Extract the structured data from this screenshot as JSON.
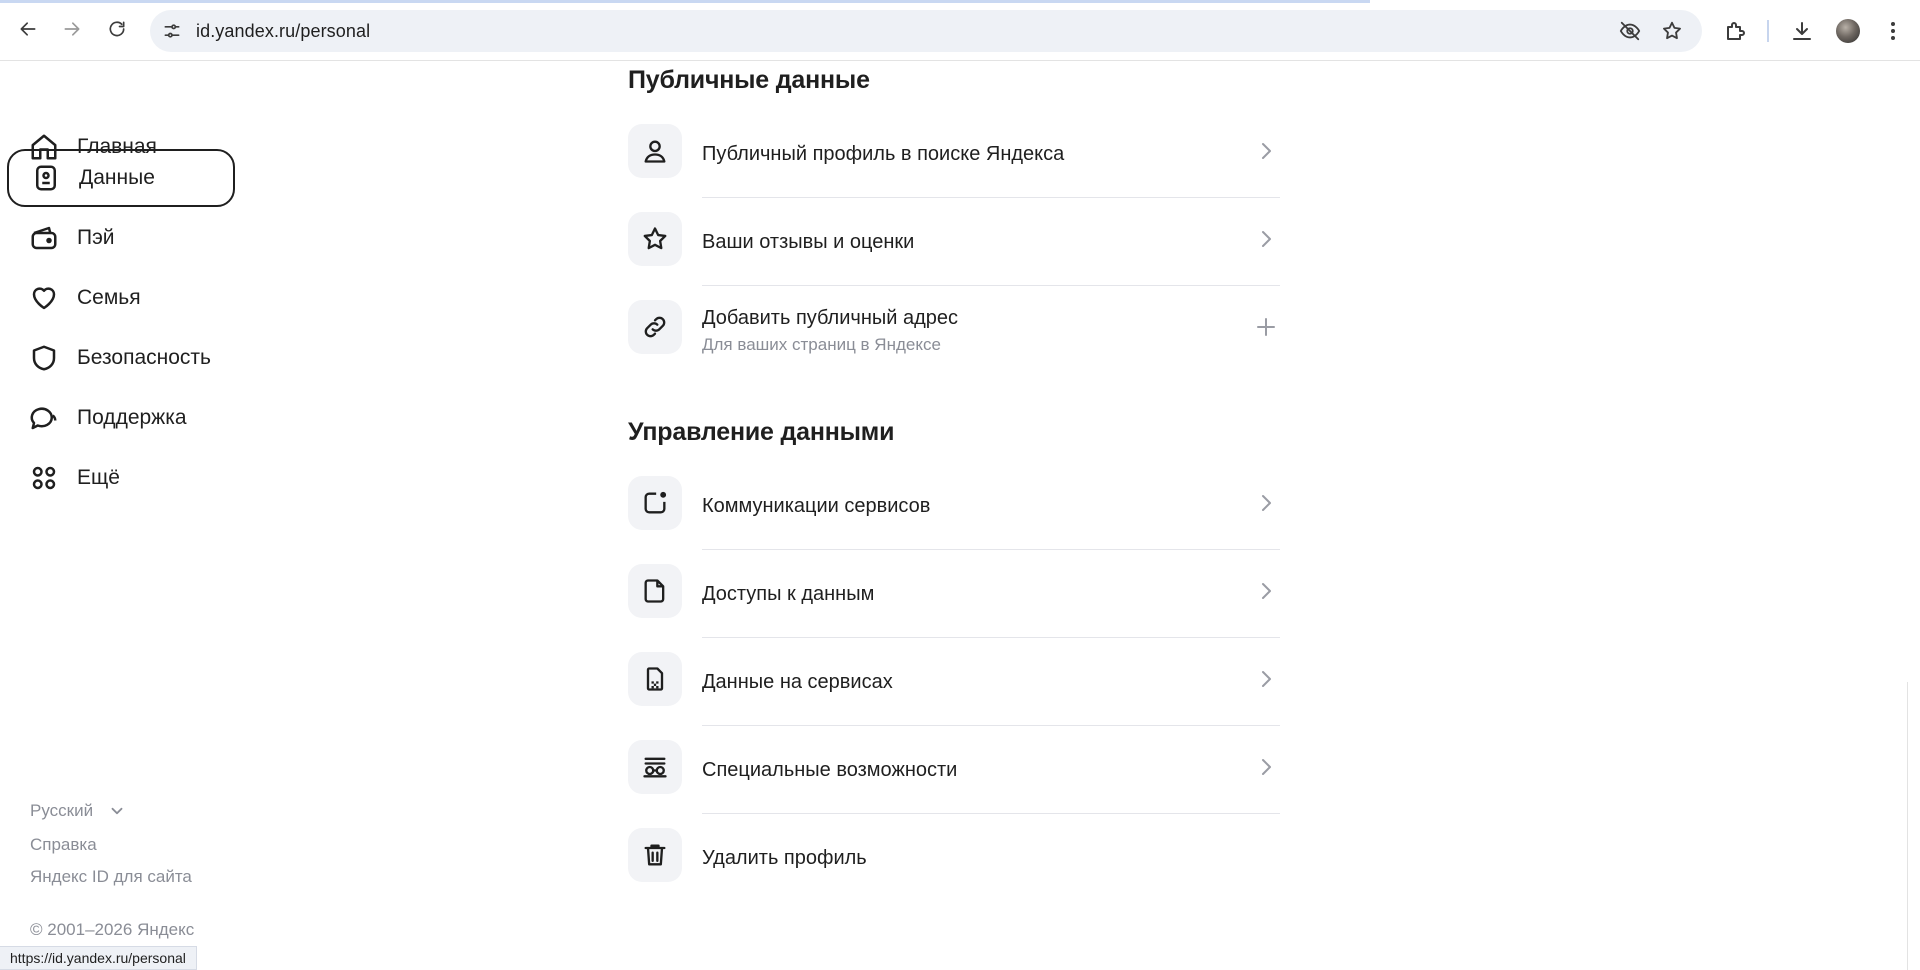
{
  "browser": {
    "url": "id.yandex.ru/personal",
    "status_url": "https://id.yandex.ru/personal"
  },
  "sidebar": {
    "items": [
      {
        "label": "Главная"
      },
      {
        "label": "Данные"
      },
      {
        "label": "Пэй"
      },
      {
        "label": "Семья"
      },
      {
        "label": "Безопасность"
      },
      {
        "label": "Поддержка"
      },
      {
        "label": "Ещё"
      }
    ],
    "active": "Данные",
    "footer": {
      "language": "Русский",
      "help": "Справка",
      "for_site": "Яндекс ID для сайта",
      "copyright": "© 2001–2026 Яндекс"
    }
  },
  "public_data": {
    "title": "Публичные данные",
    "rows": [
      {
        "title": "Публичный профиль в поиске Яндекса",
        "icon": "person-icon"
      },
      {
        "title": "Ваши отзывы и оценки",
        "icon": "star-icon"
      },
      {
        "title": "Добавить публичный адрес",
        "subtitle": "Для ваших страниц в Яндексе",
        "icon": "link-icon"
      }
    ]
  },
  "data_management": {
    "title": "Управление данными",
    "rows": [
      {
        "title": "Коммуникации сервисов",
        "icon": "notification-square-icon"
      },
      {
        "title": "Доступы к данным",
        "icon": "document-icon"
      },
      {
        "title": "Данные на сервисах",
        "icon": "data-file-icon"
      },
      {
        "title": "Специальные возможности",
        "icon": "accessibility-glasses-icon"
      },
      {
        "title": "Удалить профиль",
        "icon": "trash-icon"
      }
    ]
  }
}
